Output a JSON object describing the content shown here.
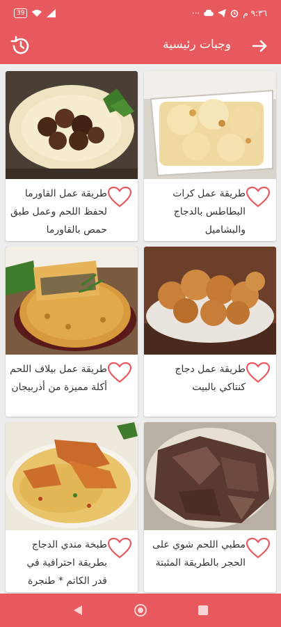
{
  "status_bar": {
    "time": "٩:٣٦ م",
    "battery": "39",
    "dots": "···"
  },
  "app_bar": {
    "title": "وجبات رئيسية",
    "icons": [
      "arrow-forward-icon",
      "history-icon"
    ]
  },
  "recipes": [
    {
      "title": "طريقة عمل كرات البطاطس بالدجاج والبشاميل",
      "icon": "heart-outline-icon"
    },
    {
      "title": "طريقة عمل القاورما لحفظ اللحم وعمل طبق حمص بالقاورما",
      "icon": "heart-outline-icon"
    },
    {
      "title": "طريقة عمل دجاج كنتاكي بالبيت",
      "icon": "heart-outline-icon"
    },
    {
      "title": "طريقة عمل بيلاف اللحم أكلة مميزة من أذربيجان",
      "icon": "heart-outline-icon"
    },
    {
      "title": "مطبي اللحم شوي على الحجر بالطريقة المثبتة",
      "icon": "heart-outline-icon"
    },
    {
      "title": "طبخة مندي الدجاج بطريقة احترافية في قدر الكاتم * طنجرة",
      "icon": "heart-outline-icon"
    }
  ],
  "colors": {
    "primary": "#e8595d",
    "heart": "#e8595d",
    "background": "#ededed",
    "card": "#ffffff",
    "text": "#333333"
  },
  "nav_bar": {
    "icons": [
      "back-triangle-icon",
      "home-circle-icon",
      "recents-square-icon"
    ]
  }
}
